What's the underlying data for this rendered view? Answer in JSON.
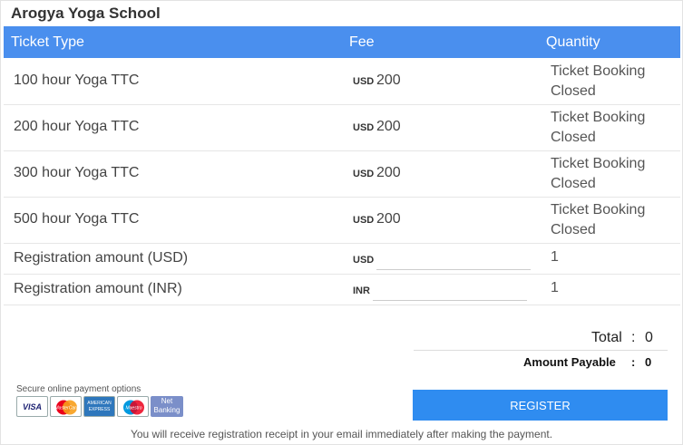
{
  "title": "Arogya Yoga School",
  "columns": {
    "ticket_type": "Ticket Type",
    "fee": "Fee",
    "quantity": "Quantity"
  },
  "rows": [
    {
      "name": "100 hour Yoga TTC",
      "currency": "USD",
      "amount": "200",
      "quantity": "Ticket Booking Closed"
    },
    {
      "name": "200 hour Yoga TTC",
      "currency": "USD",
      "amount": "200",
      "quantity": "Ticket Booking Closed"
    },
    {
      "name": "300 hour Yoga TTC",
      "currency": "USD",
      "amount": "200",
      "quantity": "Ticket Booking Closed"
    },
    {
      "name": "500 hour Yoga TTC",
      "currency": "USD",
      "amount": "200",
      "quantity": "Ticket Booking Closed"
    }
  ],
  "registration_rows": [
    {
      "name": "Registration amount (USD)",
      "currency": "USD",
      "value": "",
      "quantity": "1"
    },
    {
      "name": "Registration amount (INR)",
      "currency": "INR",
      "value": "",
      "quantity": "1"
    }
  ],
  "totals": {
    "total_label": "Total",
    "total_colon": ":",
    "total_value": "0",
    "payable_label": "Amount Payable",
    "payable_colon": ":",
    "payable_value": "0"
  },
  "payment": {
    "secure_text": "Secure online payment options",
    "cards": [
      {
        "label": "VISA",
        "icon": "visa-card-icon",
        "color": "#1a1f71"
      },
      {
        "label": "MasterCard",
        "icon": "mastercard-icon",
        "color": "#eb001b"
      },
      {
        "label": "AMERICAN EXPRESS",
        "icon": "amex-card-icon",
        "color": "#2e77bc"
      },
      {
        "label": "Maestro",
        "icon": "maestro-card-icon",
        "color": "#0099df"
      },
      {
        "label": "Net Banking",
        "icon": "net-banking-icon",
        "color": "#7b8fc9"
      }
    ]
  },
  "register_label": "REGISTER",
  "footnote": "You will receive registration receipt in your email immediately after making the payment.",
  "colors": {
    "header_bg": "#4a8fee",
    "button_bg": "#2f8cf0"
  }
}
